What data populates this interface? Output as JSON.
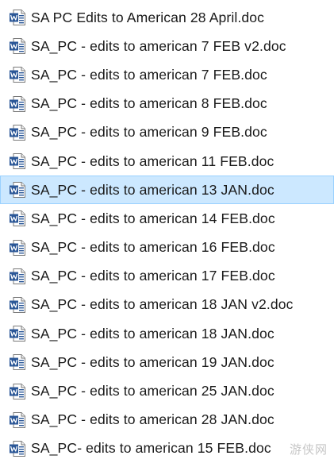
{
  "files": [
    {
      "name": "SA PC Edits to American 28 April.doc",
      "icon": "word-doc-icon",
      "selected": false
    },
    {
      "name": "SA_PC - edits to american 7 FEB v2.doc",
      "icon": "word-doc-icon",
      "selected": false
    },
    {
      "name": "SA_PC - edits to american 7 FEB.doc",
      "icon": "word-doc-icon",
      "selected": false
    },
    {
      "name": "SA_PC - edits to american 8 FEB.doc",
      "icon": "word-doc-icon",
      "selected": false
    },
    {
      "name": "SA_PC - edits to american 9 FEB.doc",
      "icon": "word-doc-icon",
      "selected": false
    },
    {
      "name": "SA_PC - edits to american 11 FEB.doc",
      "icon": "word-doc-icon",
      "selected": false
    },
    {
      "name": "SA_PC - edits to american 13 JAN.doc",
      "icon": "word-doc-icon",
      "selected": true
    },
    {
      "name": "SA_PC - edits to american 14 FEB.doc",
      "icon": "word-doc-icon",
      "selected": false
    },
    {
      "name": "SA_PC - edits to american 16 FEB.doc",
      "icon": "word-doc-icon",
      "selected": false
    },
    {
      "name": "SA_PC - edits to american 17 FEB.doc",
      "icon": "word-doc-icon",
      "selected": false
    },
    {
      "name": "SA_PC - edits to american 18 JAN v2.doc",
      "icon": "word-doc-icon",
      "selected": false
    },
    {
      "name": "SA_PC - edits to american 18 JAN.doc",
      "icon": "word-doc-icon",
      "selected": false
    },
    {
      "name": "SA_PC - edits to american 19 JAN.doc",
      "icon": "word-doc-icon",
      "selected": false
    },
    {
      "name": "SA_PC - edits to american 25 JAN.doc",
      "icon": "word-doc-icon",
      "selected": false
    },
    {
      "name": "SA_PC - edits to american 28 JAN.doc",
      "icon": "word-doc-icon",
      "selected": false
    },
    {
      "name": "SA_PC- edits to american 15 FEB.doc",
      "icon": "word-doc-icon",
      "selected": false
    }
  ],
  "colors": {
    "selection_fill": "#cce8ff",
    "selection_border": "#99d1ff",
    "icon_blue": "#2b5797",
    "text": "#1a1a1a"
  },
  "watermark": "游侠网"
}
